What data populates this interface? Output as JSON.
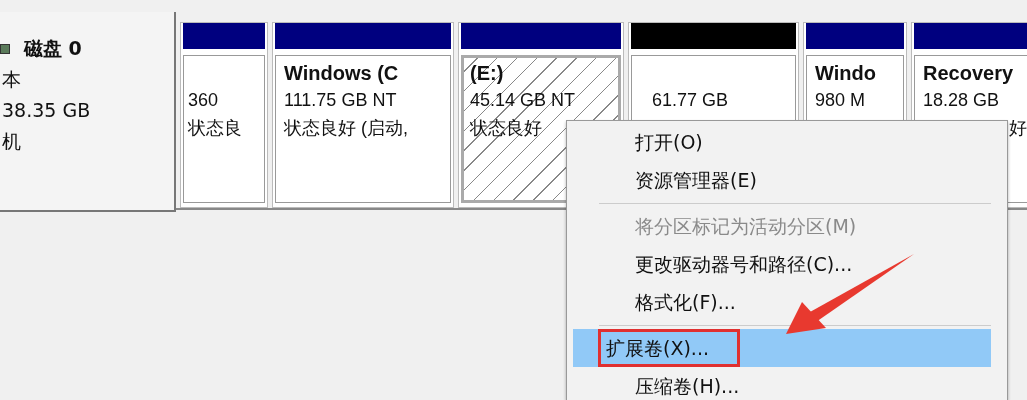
{
  "disk": {
    "name": "磁盘 0",
    "lines": [
      "本",
      "38.35 GB",
      "机"
    ]
  },
  "partitions": [
    {
      "kind": "primary",
      "selected": false,
      "lines": [
        "360",
        "状态良"
      ]
    },
    {
      "kind": "primary",
      "selected": false,
      "title": "Windows (C",
      "lines": [
        "111.75 GB NT",
        "状态良好 (启动,"
      ]
    },
    {
      "kind": "primary",
      "selected": true,
      "title": "(E:)",
      "lines": [
        "45.14 GB NT",
        "状态良好"
      ]
    },
    {
      "kind": "unallocated",
      "selected": false,
      "lines": [
        "61.77 GB"
      ]
    },
    {
      "kind": "primary",
      "selected": false,
      "title": "Windo",
      "lines": [
        "980 M"
      ]
    },
    {
      "kind": "primary",
      "selected": false,
      "title": "Recovery",
      "lines": [
        "18.28 GB",
        "好"
      ]
    }
  ],
  "context_menu": [
    {
      "kind": "item",
      "label": "打开(O)",
      "disabled": false,
      "selected": false
    },
    {
      "kind": "item",
      "label": "资源管理器(E)",
      "disabled": false,
      "selected": false
    },
    {
      "kind": "separator"
    },
    {
      "kind": "item",
      "label": "将分区标记为活动分区(M)",
      "disabled": true,
      "selected": false
    },
    {
      "kind": "item",
      "label": "更改驱动器号和路径(C)...",
      "disabled": false,
      "selected": false
    },
    {
      "kind": "item",
      "label": "格式化(F)...",
      "disabled": false,
      "selected": false
    },
    {
      "kind": "separator"
    },
    {
      "kind": "item",
      "label": "扩展卷(X)...",
      "disabled": false,
      "selected": true,
      "boxed": true
    },
    {
      "kind": "item",
      "label": "压缩卷(H)...",
      "disabled": false,
      "selected": false
    }
  ]
}
